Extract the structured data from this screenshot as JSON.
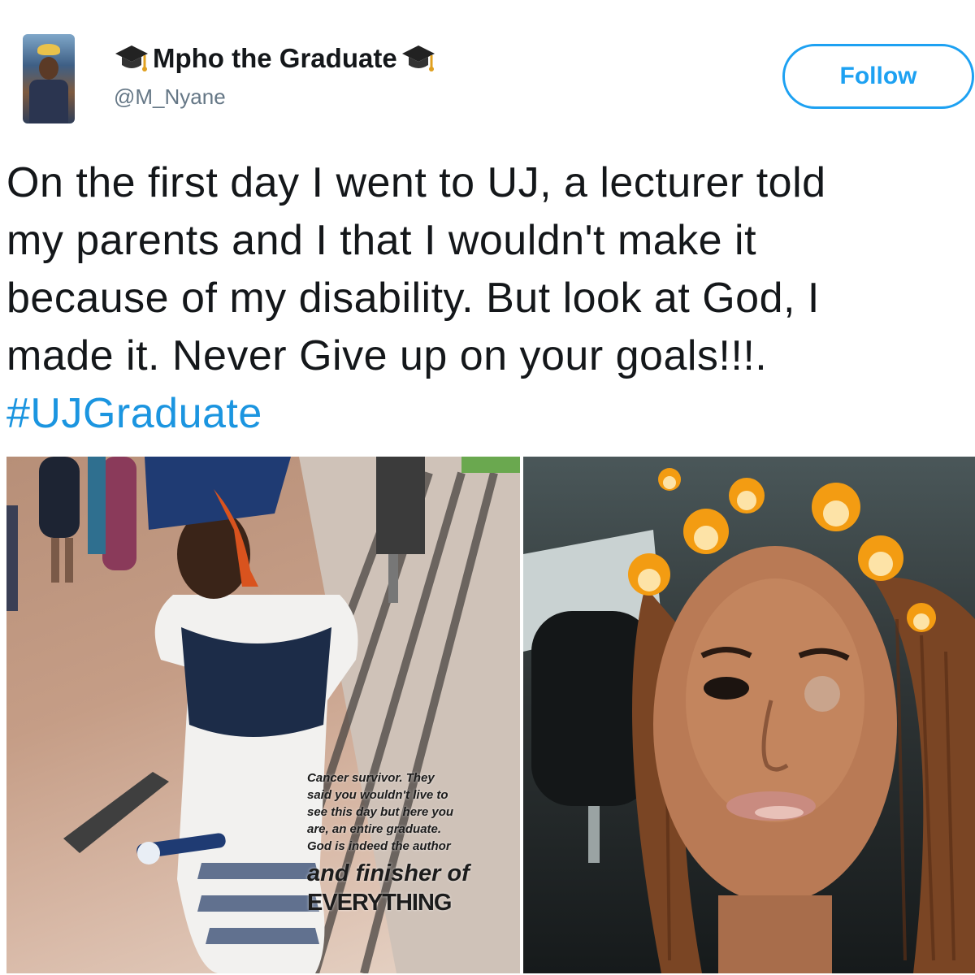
{
  "user": {
    "display_name": "Mpho the Graduate",
    "handle": "@M_Nyane"
  },
  "follow_button": {
    "label": "Follow"
  },
  "tweet": {
    "lines": [
      "On the first day I went to UJ, a lecturer told",
      "my parents and I that I wouldn't make it",
      "because of my disability. But look at God, I",
      "made it. Never Give up on your goals!!!."
    ],
    "hashtag": "#UJGraduate"
  },
  "media": {
    "left_overlay_lines": [
      "Cancer survivor. They",
      "said you wouldn't live to",
      "see this day but here you",
      "are, an entire graduate.",
      "God is indeed the author"
    ],
    "left_overlay_big": "and finisher of",
    "left_overlay_caps": "EVERYTHING"
  },
  "colors": {
    "brand_blue": "#1da1f2",
    "link_blue": "#1b95e0",
    "text": "#14171a",
    "secondary": "#657786"
  },
  "icons": [
    "graduation-cap-icon",
    "graduation-cap-icon"
  ]
}
